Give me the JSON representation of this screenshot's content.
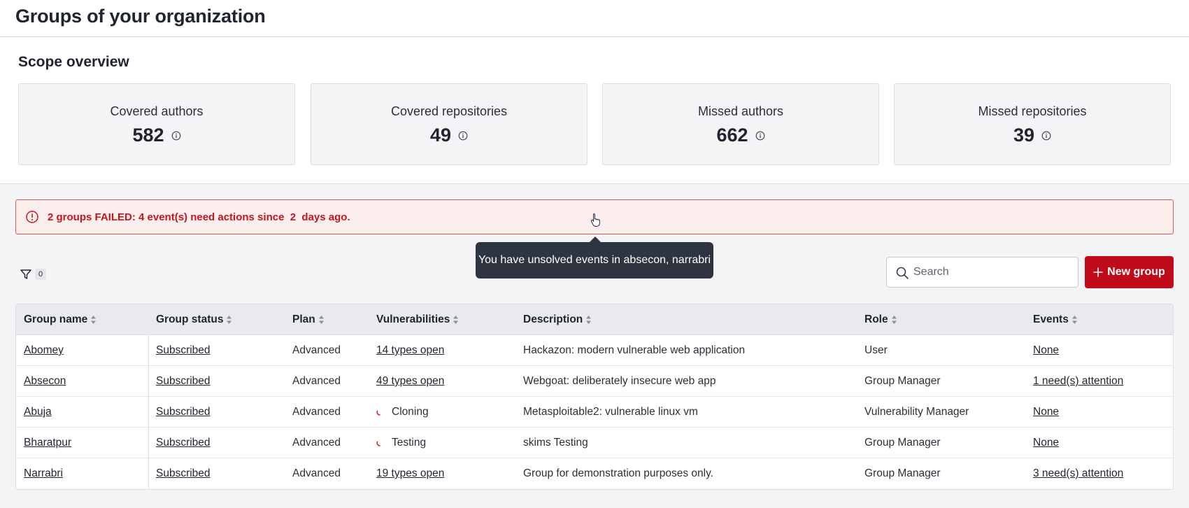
{
  "header": {
    "title": "Groups of your organization"
  },
  "scope": {
    "title": "Scope overview",
    "cards": [
      {
        "label": "Covered authors",
        "value": "582"
      },
      {
        "label": "Covered repositories",
        "value": "49"
      },
      {
        "label": "Missed authors",
        "value": "662"
      },
      {
        "label": "Missed repositories",
        "value": "39"
      }
    ]
  },
  "alert": {
    "text": "2 groups FAILED: 4 event(s) need actions since  2  days ago."
  },
  "tooltip": {
    "text": "You have unsolved events in absecon, narrabri"
  },
  "filter": {
    "count": "0"
  },
  "search": {
    "placeholder": "Search",
    "value": ""
  },
  "new_group_button": {
    "label": "New group"
  },
  "colors": {
    "accent": "#bf0b1a",
    "alert_bg": "#fdeeee",
    "alert_text": "#c5151e",
    "tooltip_bg": "#2e3541"
  },
  "table": {
    "columns": [
      "Group name",
      "Group status",
      "Plan",
      "Vulnerabilities",
      "Description",
      "Role",
      "Events"
    ],
    "rows": [
      {
        "name": "Abomey",
        "status": "Subscribed",
        "plan": "Advanced",
        "vulnerabilities": "14 types open",
        "description": "Hackazon: modern vulnerable web application",
        "role": "User",
        "events": "None"
      },
      {
        "name": "Absecon",
        "status": "Subscribed",
        "plan": "Advanced",
        "vulnerabilities": "49 types open",
        "description": "Webgoat: deliberately insecure web app",
        "role": "Group Manager",
        "events": "1 need(s) attention"
      },
      {
        "name": "Abuja",
        "status": "Subscribed",
        "plan": "Advanced",
        "vulnerabilities": "Cloning",
        "description": "Metasploitable2: vulnerable linux vm",
        "role": "Vulnerability Manager",
        "events": "None"
      },
      {
        "name": "Bharatpur",
        "status": "Subscribed",
        "plan": "Advanced",
        "vulnerabilities": "Testing",
        "description": "skims Testing",
        "role": "Group Manager",
        "events": "None"
      },
      {
        "name": "Narrabri",
        "status": "Subscribed",
        "plan": "Advanced",
        "vulnerabilities": "19 types open",
        "description": "Group for demonstration purposes only.",
        "role": "Group Manager",
        "events": "3 need(s) attention"
      }
    ]
  }
}
